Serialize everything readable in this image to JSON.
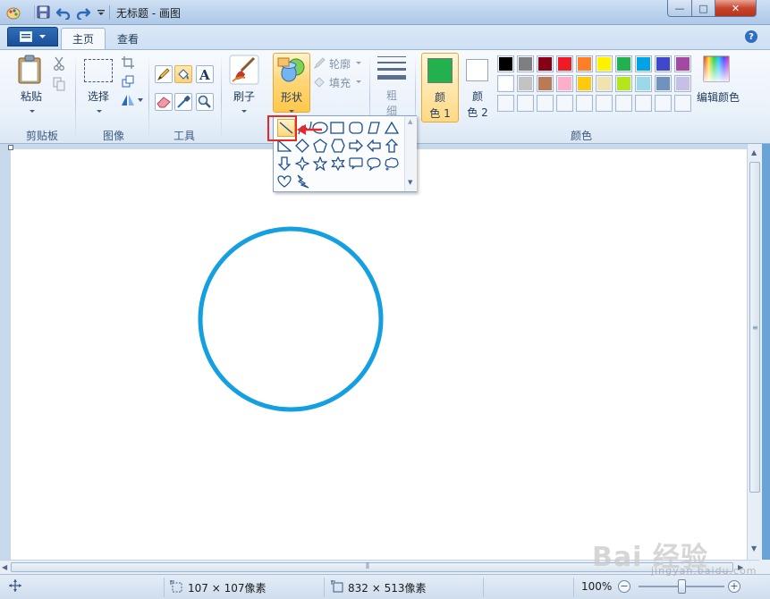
{
  "window": {
    "title": "无标题 - 画图",
    "min_glyph": "—",
    "max_glyph": "□",
    "close_glyph": "✕"
  },
  "tabs": {
    "home": "主页",
    "view": "查看"
  },
  "ribbon": {
    "clipboard": {
      "paste": "粘贴",
      "group": "剪贴板"
    },
    "image": {
      "select": "选择",
      "group": "图像"
    },
    "tools": {
      "group": "工具"
    },
    "brushes": {
      "label": "刷子"
    },
    "shapes": {
      "label": "形状",
      "outline": "轮廓",
      "fill": "填充"
    },
    "size": {
      "label_line1": "粗",
      "label_line2": "细"
    },
    "colors": {
      "color1_line1": "颜",
      "color1_line2": "色 1",
      "color2_line1": "颜",
      "color2_line2": "色 2",
      "edit": "编辑颜色",
      "group": "颜色",
      "color1": "#22b14c",
      "color2": "#ffffff",
      "palette_row1": [
        "#000000",
        "#7f7f7f",
        "#880015",
        "#ed1c24",
        "#ff7f27",
        "#fff200",
        "#22b14c",
        "#00a2e8",
        "#3f48cc",
        "#a349a4"
      ],
      "palette_row2": [
        "#ffffff",
        "#c3c3c3",
        "#b97a57",
        "#ffaec9",
        "#ffc90e",
        "#efe4b0",
        "#b5e61d",
        "#99d9ea",
        "#7092be",
        "#c8bfe7"
      ]
    }
  },
  "canvas": {
    "circle_color": "#14a0e0"
  },
  "status": {
    "selection_size": "107 × 107像素",
    "canvas_size": "832 × 513像素",
    "zoom": "100%",
    "zoom_level_fraction": 0.5
  },
  "icons": {
    "help": "?"
  },
  "watermark": {
    "main": "Bai 经验",
    "sub": "jingyan.baidu.com"
  },
  "dropdown": {
    "selected_shape": "line"
  }
}
